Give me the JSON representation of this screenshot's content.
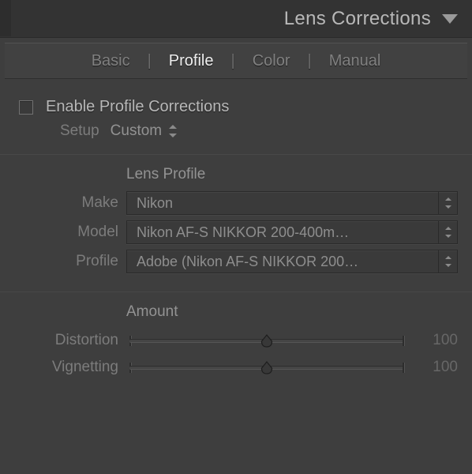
{
  "header": {
    "title": "Lens Corrections"
  },
  "tabs": {
    "items": [
      {
        "label": "Basic",
        "active": false
      },
      {
        "label": "Profile",
        "active": true
      },
      {
        "label": "Color",
        "active": false
      },
      {
        "label": "Manual",
        "active": false
      }
    ]
  },
  "enable": {
    "label": "Enable Profile Corrections",
    "checked": false
  },
  "setup": {
    "label": "Setup",
    "value": "Custom"
  },
  "lensProfile": {
    "title": "Lens Profile",
    "make": {
      "label": "Make",
      "value": "Nikon"
    },
    "model": {
      "label": "Model",
      "value": "Nikon AF-S NIKKOR 200-400m…"
    },
    "profile": {
      "label": "Profile",
      "value": "Adobe (Nikon AF-S NIKKOR 200…"
    }
  },
  "amount": {
    "title": "Amount",
    "distortion": {
      "label": "Distortion",
      "value": "100"
    },
    "vignetting": {
      "label": "Vignetting",
      "value": "100"
    }
  }
}
